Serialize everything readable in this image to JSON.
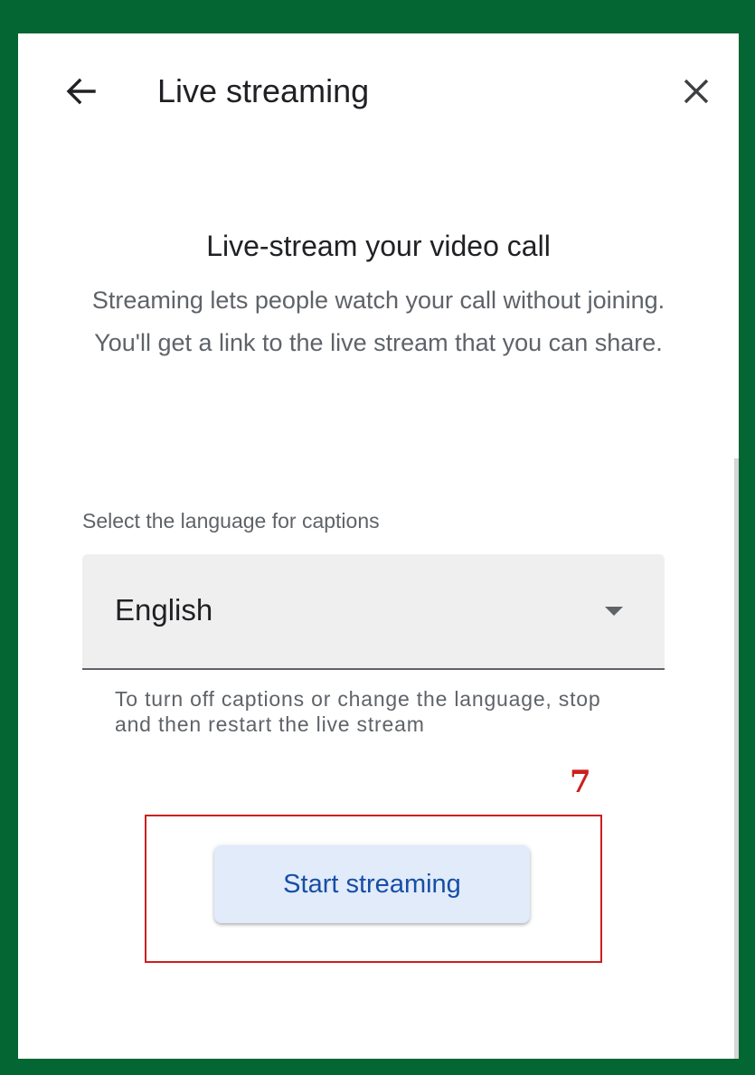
{
  "colors": {
    "frame_green": "#036633",
    "panel_bg": "#ffffff",
    "button_bg": "#e1ebfa",
    "button_text": "#174ea6",
    "annotation_red": "#cc1f1f"
  },
  "header": {
    "back_icon": "arrow-back-icon",
    "title": "Live streaming",
    "close_icon": "close-icon"
  },
  "intro": {
    "headline": "Live-stream your video call",
    "description": "Streaming lets people watch your call without joining. You'll get a link to the live stream that you can share."
  },
  "captions": {
    "label": "Select the language for captions",
    "selected_language": "English",
    "dropdown_icon": "dropdown-arrow-icon",
    "helper_text": "To turn off captions or change the language, stop and then restart the live stream"
  },
  "actions": {
    "start_label": "Start streaming"
  },
  "annotation": {
    "number": "7"
  }
}
